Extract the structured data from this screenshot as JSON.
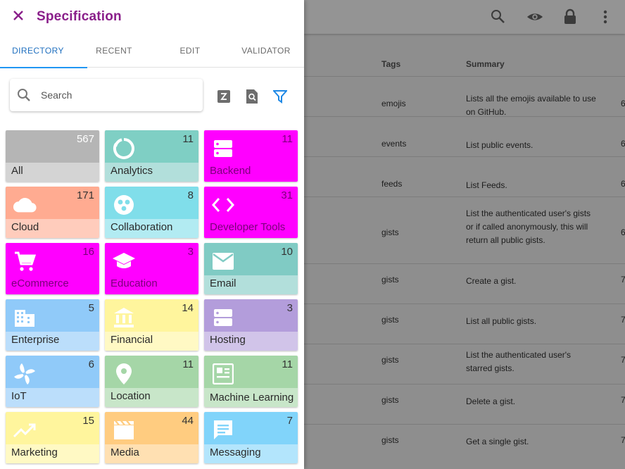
{
  "drawer": {
    "title": "Specification",
    "tabs": [
      {
        "label": "DIRECTORY",
        "active": true
      },
      {
        "label": "RECENT",
        "active": false
      },
      {
        "label": "EDIT",
        "active": false
      },
      {
        "label": "VALIDATOR",
        "active": false
      }
    ],
    "search": {
      "placeholder": "Search",
      "value": ""
    },
    "tools": [
      "sort-alpha-icon",
      "search-doc-icon",
      "filter-icon"
    ],
    "categories": [
      {
        "label": "All",
        "count": "567",
        "icon": "none",
        "top": "#b5b5b5",
        "bottom": "#d4d4d4",
        "magenta": false
      },
      {
        "label": "Analytics",
        "count": "11",
        "icon": "analytics-icon",
        "top": "#7fcfc4",
        "bottom": "#b2dfdb",
        "magenta": false
      },
      {
        "label": "Backend",
        "count": "11",
        "icon": "backend-icon",
        "top": "#ff00ff",
        "bottom": "#ff00ff",
        "magenta": true
      },
      {
        "label": "Cloud",
        "count": "171",
        "icon": "cloud-icon",
        "top": "#ffab91",
        "bottom": "#ffccbc",
        "magenta": false
      },
      {
        "label": "Collaboration",
        "count": "8",
        "icon": "collaboration-icon",
        "top": "#80deea",
        "bottom": "#b2ebf2",
        "magenta": false
      },
      {
        "label": "Developer Tools",
        "count": "31",
        "icon": "code-icon",
        "top": "#ff00ff",
        "bottom": "#ff00ff",
        "magenta": true
      },
      {
        "label": "eCommerce",
        "count": "16",
        "icon": "cart-icon",
        "top": "#ff00ff",
        "bottom": "#ff00ff",
        "magenta": true
      },
      {
        "label": "Education",
        "count": "3",
        "icon": "school-icon",
        "top": "#ff00ff",
        "bottom": "#ff00ff",
        "magenta": true
      },
      {
        "label": "Email",
        "count": "10",
        "icon": "email-icon",
        "top": "#80cbc4",
        "bottom": "#b2dfdb",
        "magenta": false
      },
      {
        "label": "Enterprise",
        "count": "5",
        "icon": "enterprise-icon",
        "top": "#90caf9",
        "bottom": "#bbdefb",
        "magenta": false
      },
      {
        "label": "Financial",
        "count": "14",
        "icon": "bank-icon",
        "top": "#fff59d",
        "bottom": "#fff9c4",
        "magenta": false
      },
      {
        "label": "Hosting",
        "count": "3",
        "icon": "hosting-icon",
        "top": "#b39ddb",
        "bottom": "#d1c4e9",
        "magenta": false
      },
      {
        "label": "IoT",
        "count": "6",
        "icon": "iot-icon",
        "top": "#90caf9",
        "bottom": "#bbdefb",
        "magenta": false
      },
      {
        "label": "Location",
        "count": "11",
        "icon": "location-icon",
        "top": "#a5d6a7",
        "bottom": "#c8e6c9",
        "magenta": false
      },
      {
        "label": "Machine Learning",
        "count": "11",
        "icon": "ml-icon",
        "top": "#a5d6a7",
        "bottom": "#c8e6c9",
        "magenta": false
      },
      {
        "label": "Marketing",
        "count": "15",
        "icon": "trending-icon",
        "top": "#fff59d",
        "bottom": "#fff9c4",
        "magenta": false
      },
      {
        "label": "Media",
        "count": "44",
        "icon": "media-icon",
        "top": "#ffcc80",
        "bottom": "#ffe0b2",
        "magenta": false
      },
      {
        "label": "Messaging",
        "count": "7",
        "icon": "message-icon",
        "top": "#81d4fa",
        "bottom": "#b3e5fc",
        "magenta": false
      }
    ]
  },
  "background": {
    "appbar_icons": [
      "search-tools-icon",
      "eye-icon",
      "lock-icon",
      "more-vert-icon"
    ],
    "table": {
      "headers": {
        "tags": "Tags",
        "summary": "Summary"
      },
      "rows": [
        {
          "tags": "emojis",
          "summary": "Lists all the emojis available to use on GitHub.",
          "num": "6"
        },
        {
          "tags": "events",
          "summary": "List public events.",
          "num": "6"
        },
        {
          "tags": "feeds",
          "summary": "List Feeds.",
          "num": "6"
        },
        {
          "tags": "gists",
          "summary": "List the authenticated user's gists or if called anonymously, this will return all public gists.",
          "num": "6"
        },
        {
          "tags": "gists",
          "summary": "Create a gist.",
          "num": "7"
        },
        {
          "tags": "gists",
          "summary": "List all public gists.",
          "num": "7"
        },
        {
          "tags": "gists",
          "summary": "List the authenticated user's starred gists.",
          "num": "7"
        },
        {
          "tags": "gists",
          "summary": "Delete a gist.",
          "num": "7"
        },
        {
          "tags": "gists",
          "summary": "Get a single gist.",
          "num": "7"
        }
      ]
    }
  }
}
